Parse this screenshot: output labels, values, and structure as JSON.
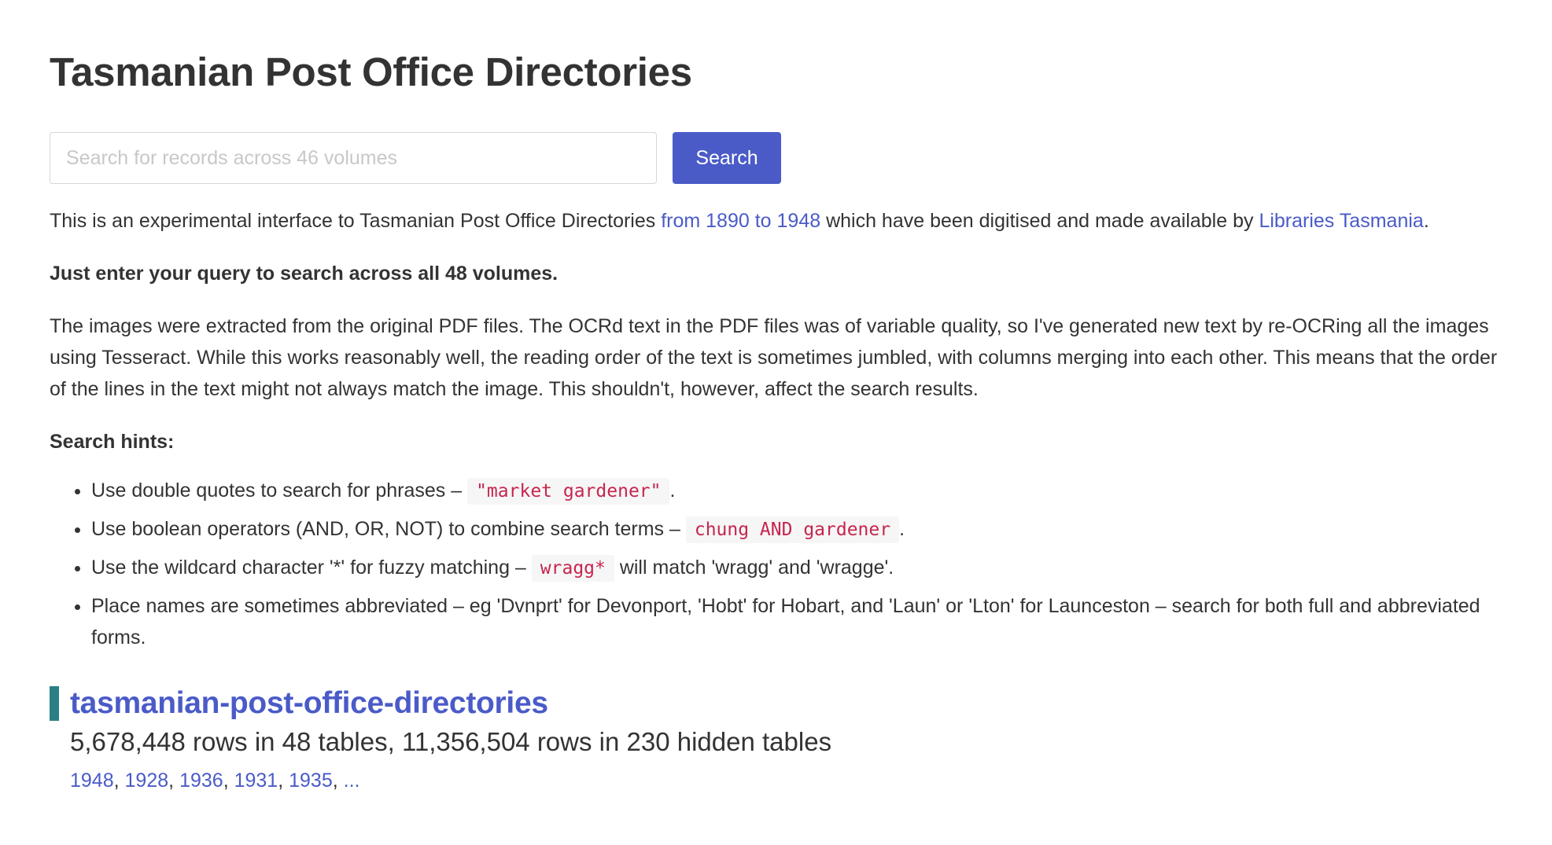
{
  "page": {
    "title": "Tasmanian Post Office Directories"
  },
  "search": {
    "placeholder": "Search for records across 46 volumes",
    "value": "",
    "button_label": "Search"
  },
  "intro": {
    "text_before": "This is an experimental interface to Tasmanian Post Office Directories ",
    "link1": "from 1890 to 1948",
    "text_middle": " which have been digitised and made available by ",
    "link2": "Libraries Tasmania",
    "text_after": "."
  },
  "bold_line": "Just enter your query to search across all 48 volumes.",
  "ocr_paragraph": "The images were extracted from the original PDF files. The OCRd text in the PDF files was of variable quality, so I've generated new text by re-OCRing all the images using Tesseract. While this works reasonably well, the reading order of the text is sometimes jumbled, with columns merging into each other. This means that the order of the lines in the text might not always match the image. This shouldn't, however, affect the search results.",
  "hints": {
    "title": "Search hints:",
    "items": [
      {
        "before": "Use double quotes to search for phrases – ",
        "code": "\"market gardener\"",
        "after": "."
      },
      {
        "before": "Use boolean operators (AND, OR, NOT) to combine search terms – ",
        "code": "chung AND gardener",
        "after": "."
      },
      {
        "before": "Use the wildcard character '*' for fuzzy matching – ",
        "code": "wragg*",
        "after": " will match 'wragg' and 'wragge'."
      },
      {
        "before": "Place names are sometimes abbreviated – eg 'Dvnprt' for Devonport, 'Hobt' for Hobart, and 'Laun' or 'Lton' for Launceston – search for both full and abbreviated forms.",
        "code": "",
        "after": ""
      }
    ]
  },
  "database": {
    "name": "tasmanian-post-office-directories",
    "counts": "5,678,448 rows in 48 tables, 11,356,504 rows in 230 hidden tables",
    "tables": [
      "1948",
      "1928",
      "1936",
      "1931",
      "1935"
    ],
    "more": "...",
    "separator": ", "
  },
  "colors": {
    "accent": "#4a5bc8",
    "db_bar": "#2a7f85",
    "code_text": "#c7254e"
  }
}
